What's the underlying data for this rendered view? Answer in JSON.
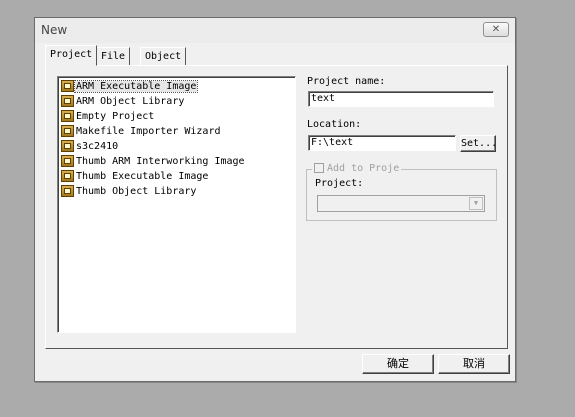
{
  "dialog": {
    "title": "New",
    "close_icon": "close-icon"
  },
  "tabs": [
    {
      "label": "Project",
      "active": true
    },
    {
      "label": "File",
      "active": false
    },
    {
      "label": "Object",
      "active": false
    }
  ],
  "project_types": [
    {
      "label": "ARM Executable Image",
      "selected": true
    },
    {
      "label": "ARM Object Library"
    },
    {
      "label": "Empty Project"
    },
    {
      "label": "Makefile Importer Wizard"
    },
    {
      "label": "s3c2410"
    },
    {
      "label": "Thumb ARM Interworking Image"
    },
    {
      "label": "Thumb Executable Image"
    },
    {
      "label": "Thumb Object Library"
    }
  ],
  "form": {
    "project_name_label": "Project name:",
    "project_name_value": "text",
    "location_label": "Location:",
    "location_value": "F:\\text",
    "set_button": "Set...",
    "add_to_project_label": "Add to Proje",
    "project_label": "Project:"
  },
  "footer": {
    "ok_button": "确定",
    "cancel_button": "取消"
  }
}
